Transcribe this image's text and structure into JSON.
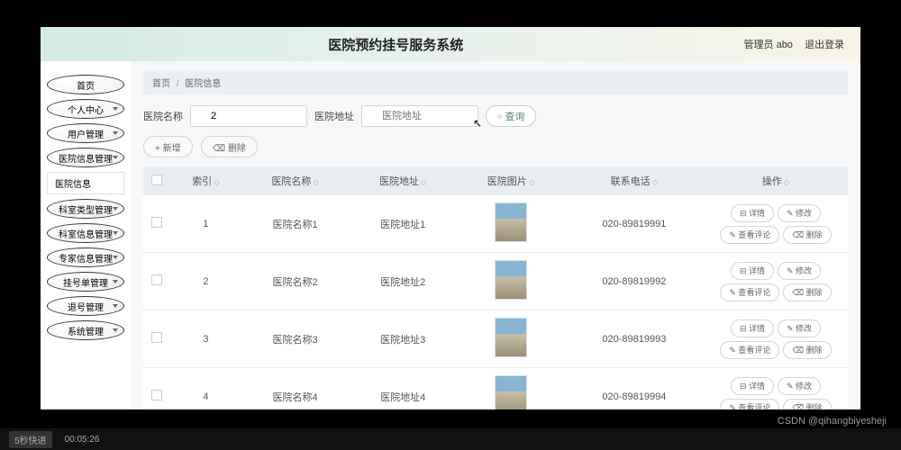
{
  "header": {
    "title": "医院预约挂号服务系统",
    "admin": "管理员 abo",
    "logout": "退出登录"
  },
  "nav": {
    "items": [
      {
        "label": "首页",
        "arrow": false
      },
      {
        "label": "个人中心",
        "arrow": true
      },
      {
        "label": "用户管理",
        "arrow": true
      },
      {
        "label": "医院信息管理",
        "arrow": true,
        "sub": "医院信息"
      },
      {
        "label": "科室类型管理",
        "arrow": true
      },
      {
        "label": "科室信息管理",
        "arrow": true
      },
      {
        "label": "专家信息管理",
        "arrow": true
      },
      {
        "label": "挂号单管理",
        "arrow": true
      },
      {
        "label": "退号管理",
        "arrow": true
      },
      {
        "label": "系统管理",
        "arrow": true
      }
    ]
  },
  "crumb": {
    "home": "首页",
    "current": "医院信息"
  },
  "search": {
    "name_label": "医院名称",
    "name_value": "2",
    "addr_label": "医院地址",
    "addr_placeholder": "医院地址",
    "query_btn": "查询"
  },
  "actions": {
    "add": "+ 新增",
    "del": "⌫ 删除"
  },
  "table": {
    "cols": [
      "",
      "索引",
      "医院名称",
      "医院地址",
      "医院图片",
      "联系电话",
      "操作"
    ],
    "rows": [
      {
        "idx": "1",
        "name": "医院名称1",
        "addr": "医院地址1",
        "phone": "020-89819991"
      },
      {
        "idx": "2",
        "name": "医院名称2",
        "addr": "医院地址2",
        "phone": "020-89819992"
      },
      {
        "idx": "3",
        "name": "医院名称3",
        "addr": "医院地址3",
        "phone": "020-89819993"
      },
      {
        "idx": "4",
        "name": "医院名称4",
        "addr": "医院地址4",
        "phone": "020-89819994"
      }
    ],
    "ops": {
      "detail": "⊟ 详情",
      "edit": "✎ 修改",
      "comment": "✎ 查看评论",
      "delete": "⌫ 删除"
    }
  },
  "video": {
    "skip": "5秒快进",
    "time": "00:05:26"
  },
  "watermark": "CSDN @qihangbiyesheji"
}
